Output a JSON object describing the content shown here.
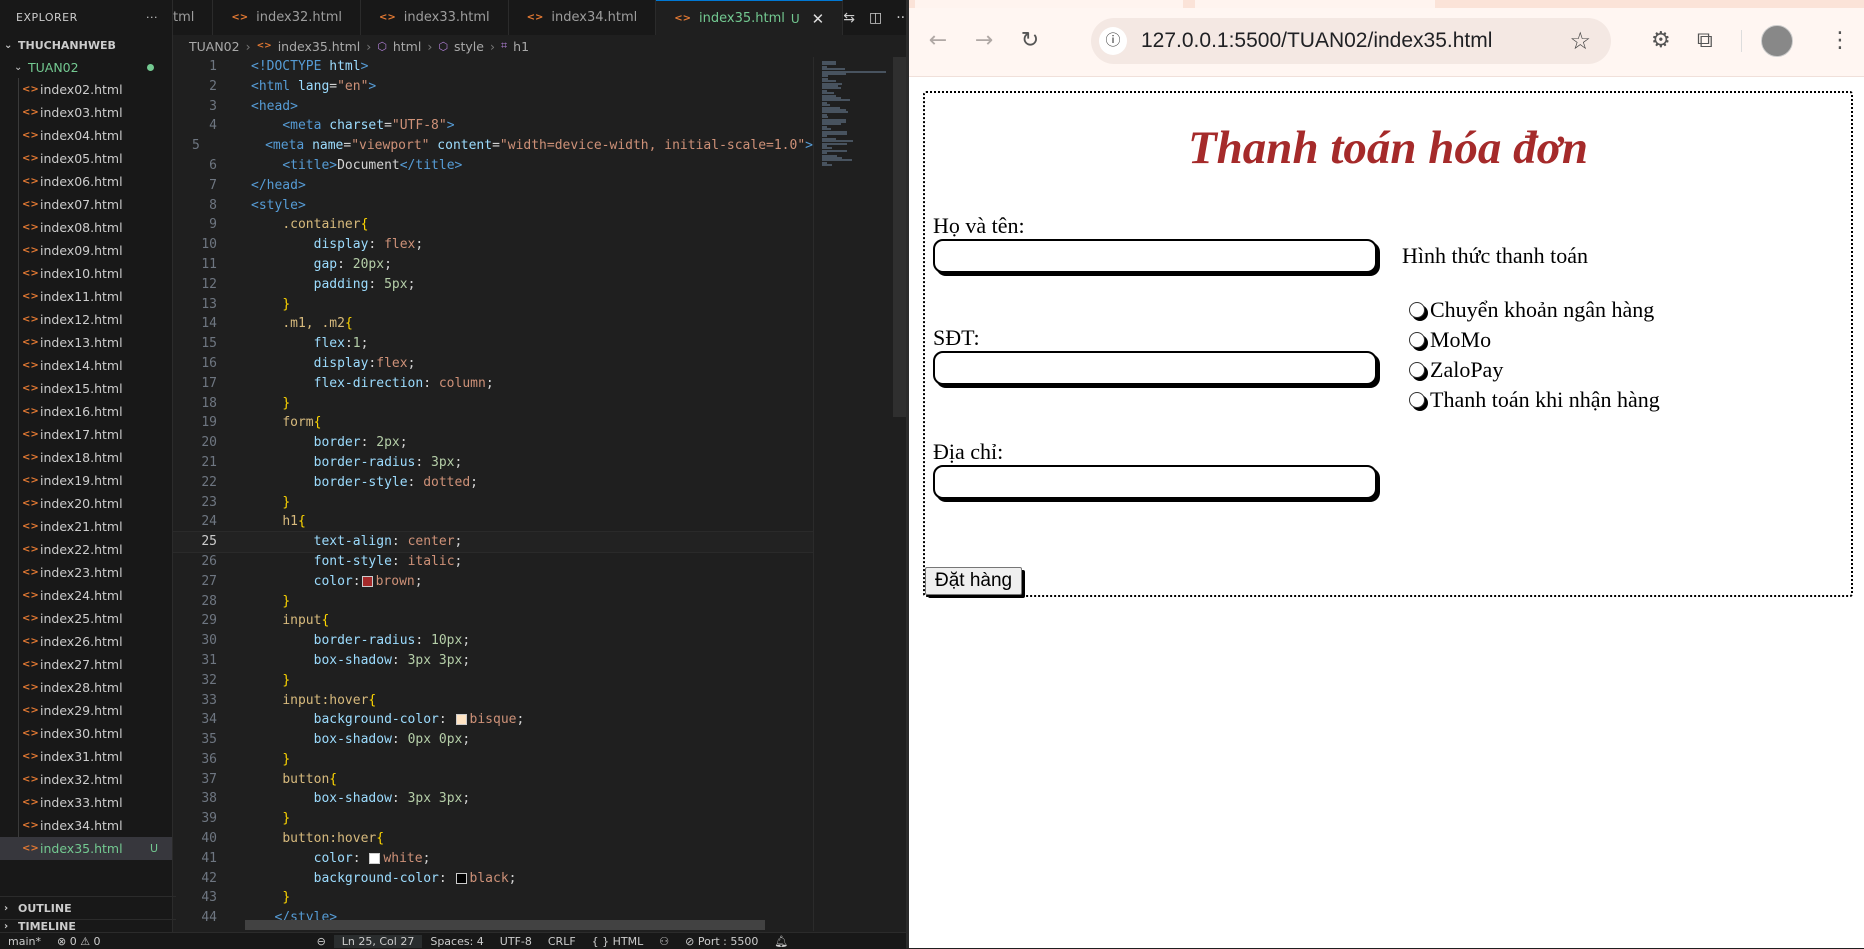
{
  "sidebar": {
    "title": "EXPLORER",
    "folder": "THUCHANHWEB",
    "subfolder": "TUAN02",
    "files": [
      "index02.html",
      "index03.html",
      "index04.html",
      "index05.html",
      "index06.html",
      "index07.html",
      "index08.html",
      "index09.html",
      "index10.html",
      "index11.html",
      "index12.html",
      "index13.html",
      "index14.html",
      "index15.html",
      "index16.html",
      "index17.html",
      "index18.html",
      "index19.html",
      "index20.html",
      "index21.html",
      "index22.html",
      "index23.html",
      "index24.html",
      "index25.html",
      "index26.html",
      "index27.html",
      "index28.html",
      "index29.html",
      "index30.html",
      "index31.html",
      "index32.html",
      "index33.html",
      "index34.html",
      "index35.html"
    ],
    "active_file": "index35.html",
    "active_badge": "U",
    "outline": "OUTLINE",
    "timeline": "TIMELINE"
  },
  "tabs": [
    {
      "label": "tml"
    },
    {
      "label": "index32.html"
    },
    {
      "label": "index33.html"
    },
    {
      "label": "index34.html"
    },
    {
      "label": "index35.html",
      "badge": "U"
    }
  ],
  "breadcrumb": {
    "root": "TUAN02",
    "file": "index35.html",
    "node1": "html",
    "node2": "style",
    "node3": "h1"
  },
  "editor": {
    "current_line": 25,
    "lines": [
      [
        [
          "t-tag",
          "<!DOCTYPE "
        ],
        [
          "t-attr",
          "html"
        ],
        [
          "t-tag",
          ">"
        ]
      ],
      [
        [
          "t-tag",
          "<html "
        ],
        [
          "t-attr",
          "lang"
        ],
        [
          "t-txt",
          "="
        ],
        [
          "t-str",
          "\"en\""
        ],
        [
          "t-tag",
          ">"
        ]
      ],
      [
        [
          "t-tag",
          "<head>"
        ]
      ],
      [
        [
          "t-txt",
          "    "
        ],
        [
          "t-tag",
          "<meta "
        ],
        [
          "t-attr",
          "charset"
        ],
        [
          "t-txt",
          "="
        ],
        [
          "t-str",
          "\"UTF-8\""
        ],
        [
          "t-tag",
          ">"
        ]
      ],
      [
        [
          "t-txt",
          "    "
        ],
        [
          "t-tag",
          "<meta "
        ],
        [
          "t-attr",
          "name"
        ],
        [
          "t-txt",
          "="
        ],
        [
          "t-str",
          "\"viewport\" "
        ],
        [
          "t-attr",
          "content"
        ],
        [
          "t-txt",
          "="
        ],
        [
          "t-str",
          "\"width=device-width, initial-scale=1.0\""
        ],
        [
          "t-tag",
          ">"
        ]
      ],
      [
        [
          "t-txt",
          "    "
        ],
        [
          "t-tag",
          "<title>"
        ],
        [
          "t-txt",
          "Document"
        ],
        [
          "t-tag",
          "</title>"
        ]
      ],
      [
        [
          "t-tag",
          "</head>"
        ]
      ],
      [
        [
          "t-tag",
          "<style>"
        ]
      ],
      [
        [
          "t-txt",
          "    "
        ],
        [
          "t-sel",
          ".container"
        ],
        [
          "t-brace",
          "{"
        ]
      ],
      [
        [
          "t-txt",
          "        "
        ],
        [
          "t-prop",
          "display"
        ],
        [
          "t-txt",
          ": "
        ],
        [
          "t-val",
          "flex"
        ],
        [
          "t-txt",
          ";"
        ]
      ],
      [
        [
          "t-txt",
          "        "
        ],
        [
          "t-prop",
          "gap"
        ],
        [
          "t-txt",
          ": "
        ],
        [
          "t-num",
          "20px"
        ],
        [
          "t-txt",
          ";"
        ]
      ],
      [
        [
          "t-txt",
          "        "
        ],
        [
          "t-prop",
          "padding"
        ],
        [
          "t-txt",
          ": "
        ],
        [
          "t-num",
          "5px"
        ],
        [
          "t-txt",
          ";"
        ]
      ],
      [
        [
          "t-txt",
          "    "
        ],
        [
          "t-brace",
          "}"
        ]
      ],
      [
        [
          "t-txt",
          "    "
        ],
        [
          "t-sel",
          ".m1, .m2"
        ],
        [
          "t-brace",
          "{"
        ]
      ],
      [
        [
          "t-txt",
          "        "
        ],
        [
          "t-prop",
          "flex"
        ],
        [
          "t-txt",
          ":"
        ],
        [
          "t-num",
          "1"
        ],
        [
          "t-txt",
          ";"
        ]
      ],
      [
        [
          "t-txt",
          "        "
        ],
        [
          "t-prop",
          "display"
        ],
        [
          "t-txt",
          ":"
        ],
        [
          "t-val",
          "flex"
        ],
        [
          "t-txt",
          ";"
        ]
      ],
      [
        [
          "t-txt",
          "        "
        ],
        [
          "t-prop",
          "flex-direction"
        ],
        [
          "t-txt",
          ": "
        ],
        [
          "t-val",
          "column"
        ],
        [
          "t-txt",
          ";"
        ]
      ],
      [
        [
          "t-txt",
          "    "
        ],
        [
          "t-brace",
          "}"
        ]
      ],
      [
        [
          "t-txt",
          "    "
        ],
        [
          "t-sel",
          "form"
        ],
        [
          "t-brace",
          "{"
        ]
      ],
      [
        [
          "t-txt",
          "        "
        ],
        [
          "t-prop",
          "border"
        ],
        [
          "t-txt",
          ": "
        ],
        [
          "t-num",
          "2px"
        ],
        [
          "t-txt",
          ";"
        ]
      ],
      [
        [
          "t-txt",
          "        "
        ],
        [
          "t-prop",
          "border-radius"
        ],
        [
          "t-txt",
          ": "
        ],
        [
          "t-num",
          "3px"
        ],
        [
          "t-txt",
          ";"
        ]
      ],
      [
        [
          "t-txt",
          "        "
        ],
        [
          "t-prop",
          "border-style"
        ],
        [
          "t-txt",
          ": "
        ],
        [
          "t-val",
          "dotted"
        ],
        [
          "t-txt",
          ";"
        ]
      ],
      [
        [
          "t-txt",
          "    "
        ],
        [
          "t-brace",
          "}"
        ]
      ],
      [
        [
          "t-txt",
          "    "
        ],
        [
          "t-sel",
          "h1"
        ],
        [
          "t-brace",
          "{"
        ]
      ],
      [
        [
          "t-txt",
          "        "
        ],
        [
          "t-prop",
          "text-align"
        ],
        [
          "t-txt",
          ": "
        ],
        [
          "t-val",
          "center"
        ],
        [
          "t-txt",
          ";"
        ]
      ],
      [
        [
          "t-txt",
          "        "
        ],
        [
          "t-prop",
          "font-style"
        ],
        [
          "t-txt",
          ": "
        ],
        [
          "t-val",
          "italic"
        ],
        [
          "t-txt",
          ";"
        ]
      ],
      [
        [
          "t-txt",
          "        "
        ],
        [
          "t-prop",
          "color"
        ],
        [
          "t-txt",
          ":"
        ],
        [
          "swatch",
          "#a52a2a"
        ],
        [
          "t-val",
          "brown"
        ],
        [
          "t-txt",
          ";"
        ]
      ],
      [
        [
          "t-txt",
          "    "
        ],
        [
          "t-brace",
          "}"
        ]
      ],
      [
        [
          "t-txt",
          "    "
        ],
        [
          "t-sel",
          "input"
        ],
        [
          "t-brace",
          "{"
        ]
      ],
      [
        [
          "t-txt",
          "        "
        ],
        [
          "t-prop",
          "border-radius"
        ],
        [
          "t-txt",
          ": "
        ],
        [
          "t-num",
          "10px"
        ],
        [
          "t-txt",
          ";"
        ]
      ],
      [
        [
          "t-txt",
          "        "
        ],
        [
          "t-prop",
          "box-shadow"
        ],
        [
          "t-txt",
          ": "
        ],
        [
          "t-num",
          "3px 3px"
        ],
        [
          "t-txt",
          ";"
        ]
      ],
      [
        [
          "t-txt",
          "    "
        ],
        [
          "t-brace",
          "}"
        ]
      ],
      [
        [
          "t-txt",
          "    "
        ],
        [
          "t-sel",
          "input:hover"
        ],
        [
          "t-brace",
          "{"
        ]
      ],
      [
        [
          "t-txt",
          "        "
        ],
        [
          "t-prop",
          "background-color"
        ],
        [
          "t-txt",
          ": "
        ],
        [
          "swatch",
          "#ffe4c4"
        ],
        [
          "t-val",
          "bisque"
        ],
        [
          "t-txt",
          ";"
        ]
      ],
      [
        [
          "t-txt",
          "        "
        ],
        [
          "t-prop",
          "box-shadow"
        ],
        [
          "t-txt",
          ": "
        ],
        [
          "t-num",
          "0px 0px"
        ],
        [
          "t-txt",
          ";"
        ]
      ],
      [
        [
          "t-txt",
          "    "
        ],
        [
          "t-brace",
          "}"
        ]
      ],
      [
        [
          "t-txt",
          "    "
        ],
        [
          "t-sel",
          "button"
        ],
        [
          "t-brace",
          "{"
        ]
      ],
      [
        [
          "t-txt",
          "        "
        ],
        [
          "t-prop",
          "box-shadow"
        ],
        [
          "t-txt",
          ": "
        ],
        [
          "t-num",
          "3px 3px"
        ],
        [
          "t-txt",
          ";"
        ]
      ],
      [
        [
          "t-txt",
          "    "
        ],
        [
          "t-brace",
          "}"
        ]
      ],
      [
        [
          "t-txt",
          "    "
        ],
        [
          "t-sel",
          "button:hover"
        ],
        [
          "t-brace",
          "{"
        ]
      ],
      [
        [
          "t-txt",
          "        "
        ],
        [
          "t-prop",
          "color"
        ],
        [
          "t-txt",
          ": "
        ],
        [
          "swatch",
          "#ffffff"
        ],
        [
          "t-val",
          "white"
        ],
        [
          "t-txt",
          ";"
        ]
      ],
      [
        [
          "t-txt",
          "        "
        ],
        [
          "t-prop",
          "background-color"
        ],
        [
          "t-txt",
          ": "
        ],
        [
          "swatch",
          "#000000"
        ],
        [
          "t-val",
          "black"
        ],
        [
          "t-txt",
          ";"
        ]
      ],
      [
        [
          "t-txt",
          "    "
        ],
        [
          "t-brace",
          "}"
        ]
      ],
      [
        [
          "t-txt",
          "   "
        ],
        [
          "t-tag",
          "</style>"
        ]
      ]
    ]
  },
  "status": {
    "branch": "main*",
    "problems": "⊗ 0 ⚠ 0",
    "position": "Ln 25, Col 27",
    "spaces": "Spaces: 4",
    "encoding": "UTF-8",
    "eol": "CRLF",
    "language": "{ } HTML",
    "port": "⊘ Port : 5500"
  },
  "browser": {
    "url": "127.0.0.1:5500/TUAN02/index35.html"
  },
  "page": {
    "heading": "Thanh toán hóa đơn",
    "name_label": "Họ và tên:",
    "phone_label": "SĐT:",
    "address_label": "Địa chỉ:",
    "payment_title": "Hình thức thanh toán",
    "payment_options": [
      "Chuyển khoản ngân hàng",
      "MoMo",
      "ZaloPay",
      "Thanh toán khi nhận hàng"
    ],
    "submit_label": "Đặt hàng"
  }
}
